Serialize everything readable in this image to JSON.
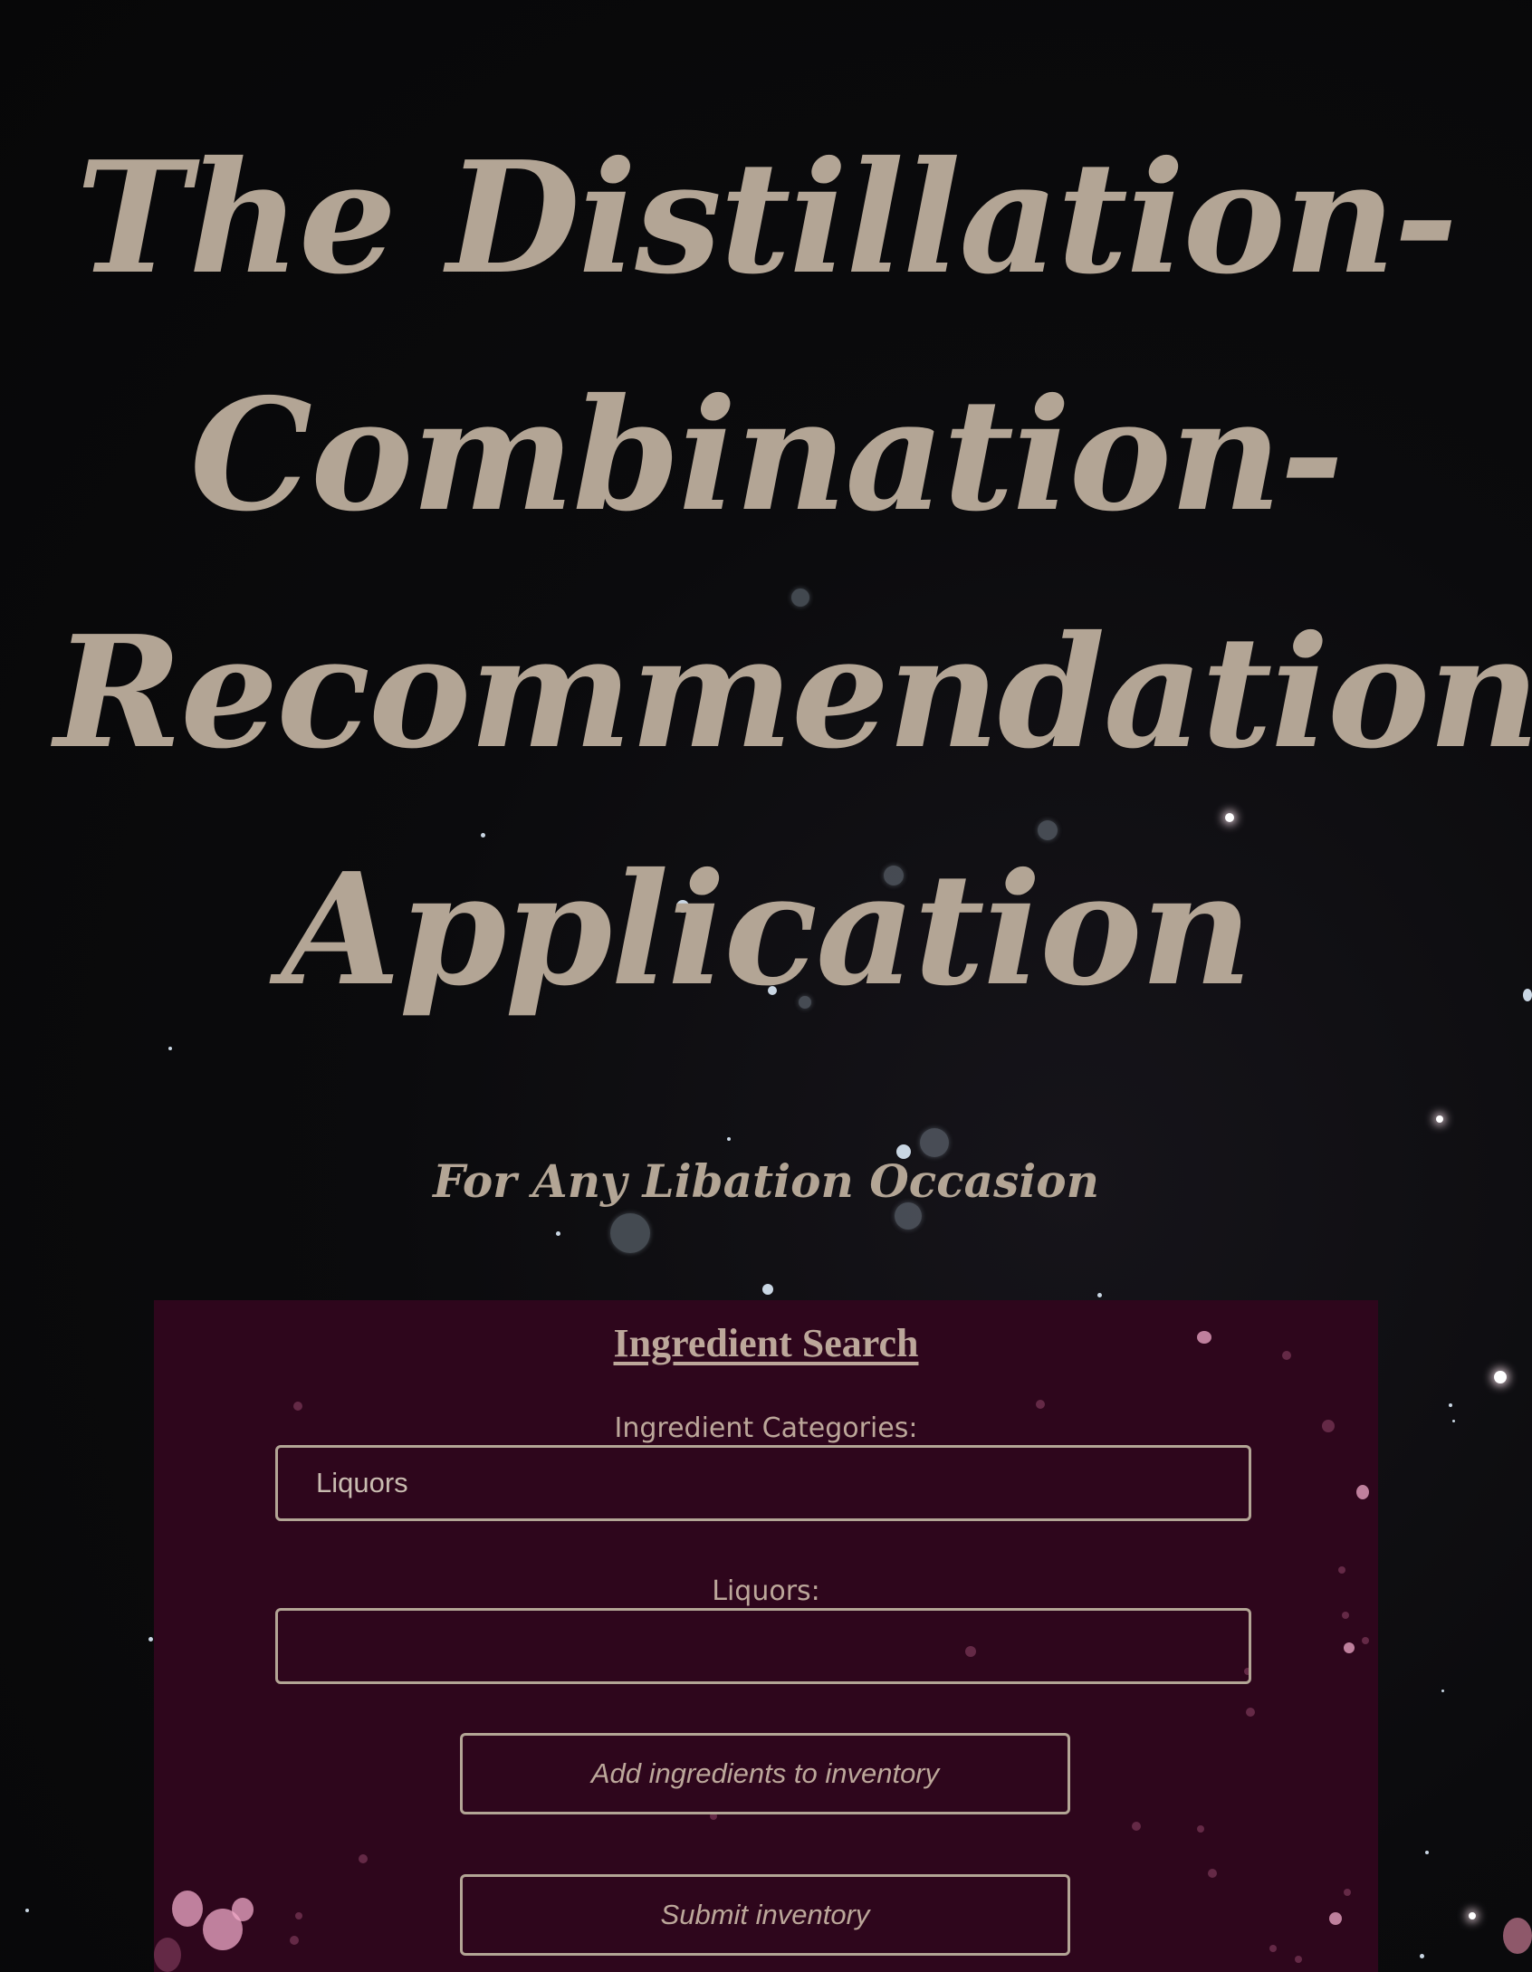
{
  "header": {
    "title": "The Distillation-Combination-Recommendation-Application",
    "subtitle": "For Any Libation Occasion"
  },
  "ingredient_search": {
    "heading": "Ingredient Search",
    "category_label": "Ingredient Categories:",
    "category_value": "Liquors",
    "liquor_label": "Liquors:",
    "liquor_value": "",
    "add_button_label": "Add ingredients to inventory",
    "submit_button_label": "Submit inventory"
  },
  "colors": {
    "background": "#0a0a0c",
    "text": "#b3a595",
    "panel": "#2e061c",
    "border": "#b3a595"
  }
}
